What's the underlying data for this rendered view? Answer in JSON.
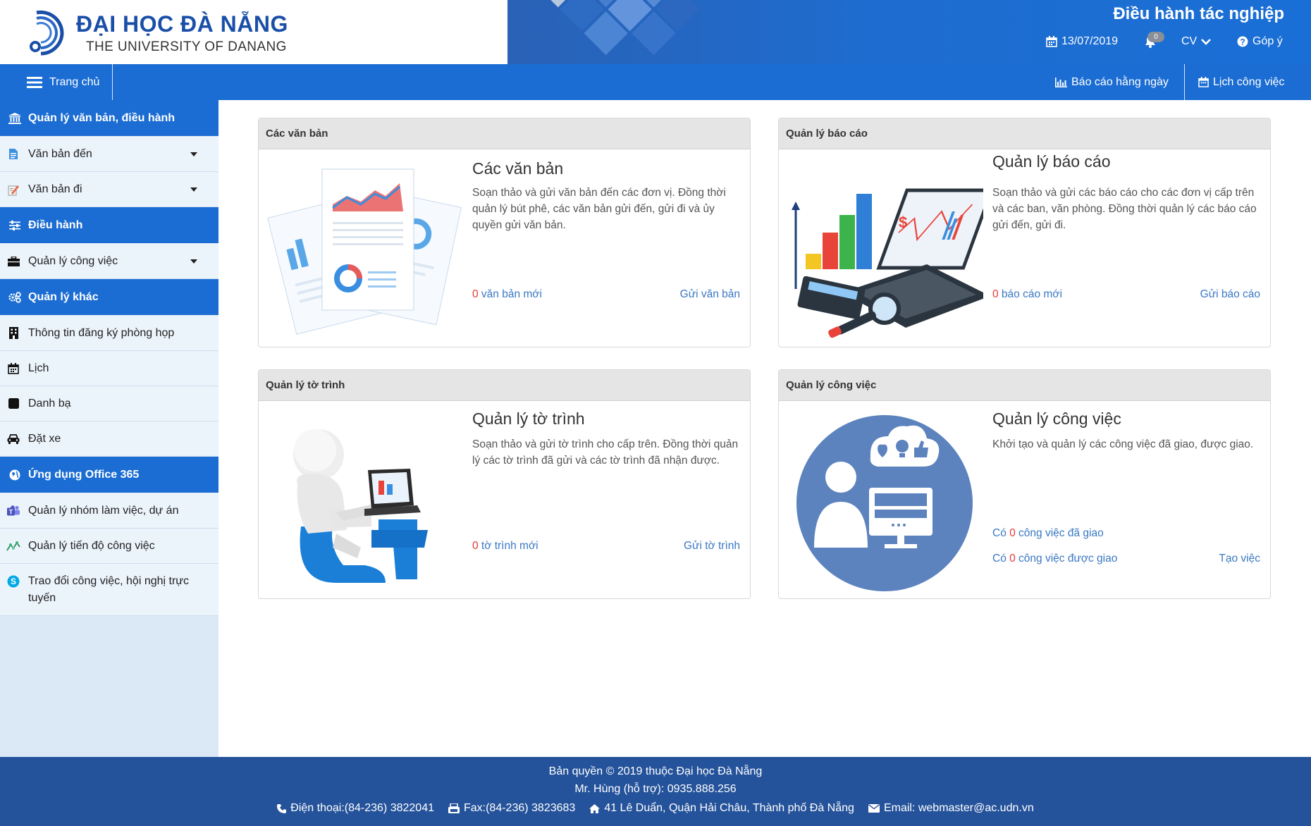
{
  "header": {
    "brand_title": "ĐẠI HỌC ĐÀ NẴNG",
    "brand_sub": "THE UNIVERSITY OF DANANG",
    "app_title": "Điều hành tác nghiệp",
    "date": "13/07/2019",
    "bell_count": "0",
    "user": "CV",
    "feedback": "Góp ý",
    "colors": {
      "brand": "#1a4fa8",
      "accent": "#1b6dd3"
    }
  },
  "navbar": {
    "home": "Trang chủ",
    "report_daily": "Báo cáo hằng ngày",
    "work_calendar": "Lịch công việc"
  },
  "sidebar": {
    "sections": [
      {
        "title": "Quản lý văn bản, điều hành",
        "icon": "bank-icon"
      },
      {
        "title": "Điều hành",
        "icon": "sliders-icon"
      },
      {
        "title": "Quản lý khác",
        "icon": "gears-icon"
      },
      {
        "title": "Ứng dụng Office 365",
        "icon": "globe-icon"
      }
    ],
    "items": {
      "incoming": "Văn bản đến",
      "outgoing": "Văn bản đi",
      "tasks": "Quản lý công việc",
      "meeting_room": "Thông tin đăng ký phòng họp",
      "calendar": "Lịch",
      "contacts": "Danh bạ",
      "car_booking": "Đặt xe",
      "teams": "Quản lý nhóm làm việc, dự án",
      "planner": "Quản lý tiến độ công việc",
      "skype": "Trao đổi công việc, hội nghị trực tuyến"
    }
  },
  "cards": {
    "documents": {
      "header": "Các văn bản",
      "title": "Các văn bản",
      "desc": "Soạn thảo và gửi văn bản đến các đơn vị. Đồng thời quản lý bút phê, các văn bản gửi đến, gửi đi và ủy quyền gửi văn bản.",
      "count": "0",
      "count_label": " văn bản mới",
      "action": "Gửi văn bản"
    },
    "reports": {
      "header": "Quản lý báo cáo",
      "title": "Quản lý báo cáo",
      "desc": "Soạn thảo và gửi các báo cáo cho các đơn vị cấp trên và các ban, văn phòng. Đồng thời quản lý các báo cáo gửi đến, gửi đi.",
      "count": "0",
      "count_label": " báo cáo mới",
      "action": "Gửi báo cáo"
    },
    "submissions": {
      "header": "Quản lý tờ trình",
      "title": "Quản lý tờ trình",
      "desc": "Soạn thảo và gửi tờ trình cho cấp trên. Đồng thời quản lý các tờ trình đã gửi và các tờ trình đã nhận được.",
      "count": "0",
      "count_label": " tờ trình mới",
      "action": "Gửi tờ trình"
    },
    "work": {
      "header": "Quản lý công việc",
      "title": "Quản lý công việc",
      "desc": "Khởi tạo và quản lý các công việc đã giao, được giao.",
      "assigned_prefix": "Có ",
      "assigned_count": "0",
      "assigned_suffix": " công việc đã giao",
      "received_prefix": "Có ",
      "received_count": "0",
      "received_suffix": " công việc được giao",
      "action": "Tạo việc"
    }
  },
  "footer": {
    "copyright": "Bản quyền © 2019 thuộc Đại học Đà Nẵng",
    "support": "Mr. Hùng (hỗ trợ): 0935.888.256",
    "phone": "Điện thoại:(84-236) 3822041",
    "fax": "Fax:(84-236) 3823683",
    "address": "41 Lê Duẩn, Quận Hải Châu, Thành phố Đà Nẵng",
    "email": "Email: webmaster@ac.udn.vn"
  }
}
